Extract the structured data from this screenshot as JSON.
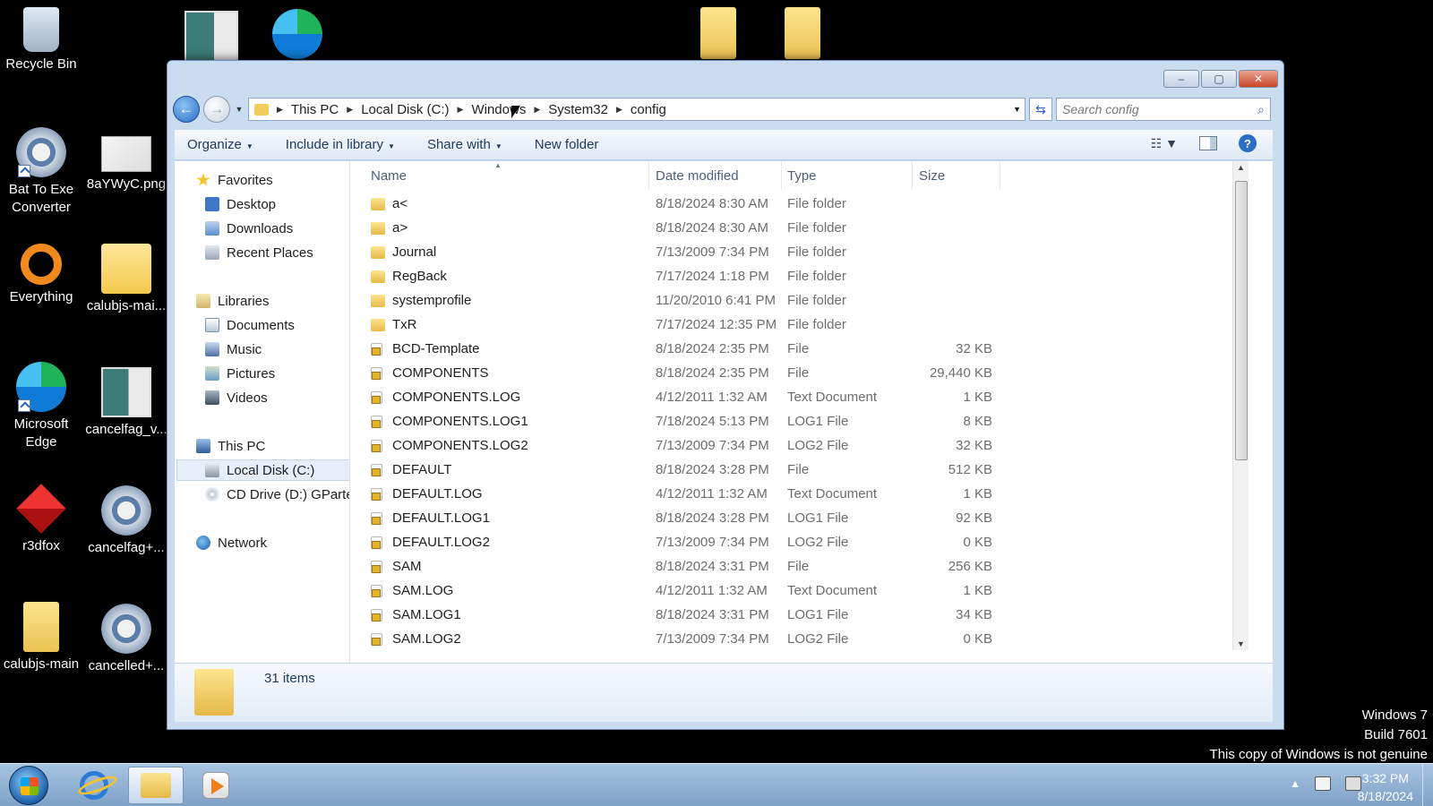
{
  "desktop": {
    "icons": [
      {
        "label": "Recycle Bin"
      },
      {
        "label": "Bat To Exe Converter"
      },
      {
        "label": "8aYWyC.png"
      },
      {
        "label": "Everything"
      },
      {
        "label": "calubjs-mai..."
      },
      {
        "label": "Microsoft Edge"
      },
      {
        "label": "cancelfag_v..."
      },
      {
        "label": "r3dfox"
      },
      {
        "label": "cancelfag+..."
      },
      {
        "label": "calubjs-main"
      },
      {
        "label": "cancelled+..."
      }
    ]
  },
  "window": {
    "controls": {
      "minimize": "–",
      "maximize": "▢",
      "close": "✕"
    },
    "address": {
      "crumbs": [
        "This PC",
        "Local Disk (C:)",
        "Windows",
        "System32",
        "config"
      ]
    },
    "search": {
      "placeholder": "Search config"
    },
    "toolbar": {
      "organize": "Organize",
      "include": "Include in library",
      "share": "Share with",
      "new_folder": "New folder"
    },
    "navpane": {
      "favorites": "Favorites",
      "desktop": "Desktop",
      "downloads": "Downloads",
      "recent": "Recent Places",
      "libraries": "Libraries",
      "documents": "Documents",
      "music": "Music",
      "pictures": "Pictures",
      "videos": "Videos",
      "this_pc": "This PC",
      "local_disk": "Local Disk (C:)",
      "cd_drive": "CD Drive (D:) GParted",
      "network": "Network"
    },
    "columns": {
      "name": "Name",
      "date": "Date modified",
      "type": "Type",
      "size": "Size"
    },
    "files": [
      {
        "name": "a<",
        "date": "8/18/2024 8:30 AM",
        "type": "File folder",
        "size": ""
      },
      {
        "name": "a>",
        "date": "8/18/2024 8:30 AM",
        "type": "File folder",
        "size": ""
      },
      {
        "name": "Journal",
        "date": "7/13/2009 7:34 PM",
        "type": "File folder",
        "size": ""
      },
      {
        "name": "RegBack",
        "date": "7/17/2024 1:18 PM",
        "type": "File folder",
        "size": ""
      },
      {
        "name": "systemprofile",
        "date": "11/20/2010 6:41 PM",
        "type": "File folder",
        "size": ""
      },
      {
        "name": "TxR",
        "date": "7/17/2024 12:35 PM",
        "type": "File folder",
        "size": ""
      },
      {
        "name": "BCD-Template",
        "date": "8/18/2024 2:35 PM",
        "type": "File",
        "size": "32 KB"
      },
      {
        "name": "COMPONENTS",
        "date": "8/18/2024 2:35 PM",
        "type": "File",
        "size": "29,440 KB"
      },
      {
        "name": "COMPONENTS.LOG",
        "date": "4/12/2011 1:32 AM",
        "type": "Text Document",
        "size": "1 KB"
      },
      {
        "name": "COMPONENTS.LOG1",
        "date": "7/18/2024 5:13 PM",
        "type": "LOG1 File",
        "size": "8 KB"
      },
      {
        "name": "COMPONENTS.LOG2",
        "date": "7/13/2009 7:34 PM",
        "type": "LOG2 File",
        "size": "32 KB"
      },
      {
        "name": "DEFAULT",
        "date": "8/18/2024 3:28 PM",
        "type": "File",
        "size": "512 KB"
      },
      {
        "name": "DEFAULT.LOG",
        "date": "4/12/2011 1:32 AM",
        "type": "Text Document",
        "size": "1 KB"
      },
      {
        "name": "DEFAULT.LOG1",
        "date": "8/18/2024 3:28 PM",
        "type": "LOG1 File",
        "size": "92 KB"
      },
      {
        "name": "DEFAULT.LOG2",
        "date": "7/13/2009 7:34 PM",
        "type": "LOG2 File",
        "size": "0 KB"
      },
      {
        "name": "SAM",
        "date": "8/18/2024 3:31 PM",
        "type": "File",
        "size": "256 KB"
      },
      {
        "name": "SAM.LOG",
        "date": "4/12/2011 1:32 AM",
        "type": "Text Document",
        "size": "1 KB"
      },
      {
        "name": "SAM.LOG1",
        "date": "8/18/2024 3:31 PM",
        "type": "LOG1 File",
        "size": "34 KB"
      },
      {
        "name": "SAM.LOG2",
        "date": "7/13/2009 7:34 PM",
        "type": "LOG2 File",
        "size": "0 KB"
      }
    ],
    "status": {
      "count": "31 items"
    }
  },
  "watermark": {
    "line1": "Windows 7",
    "line2": "Build 7601",
    "line3": "This copy of Windows is not genuine"
  },
  "taskbar": {
    "time": "3:32 PM",
    "date": "8/18/2024"
  },
  "colors": {
    "window_frame": "#c9dcf0",
    "toolbar_text": "#1e395b",
    "secondary_text": "#6d6d6d",
    "selection": "#e5eef9"
  }
}
